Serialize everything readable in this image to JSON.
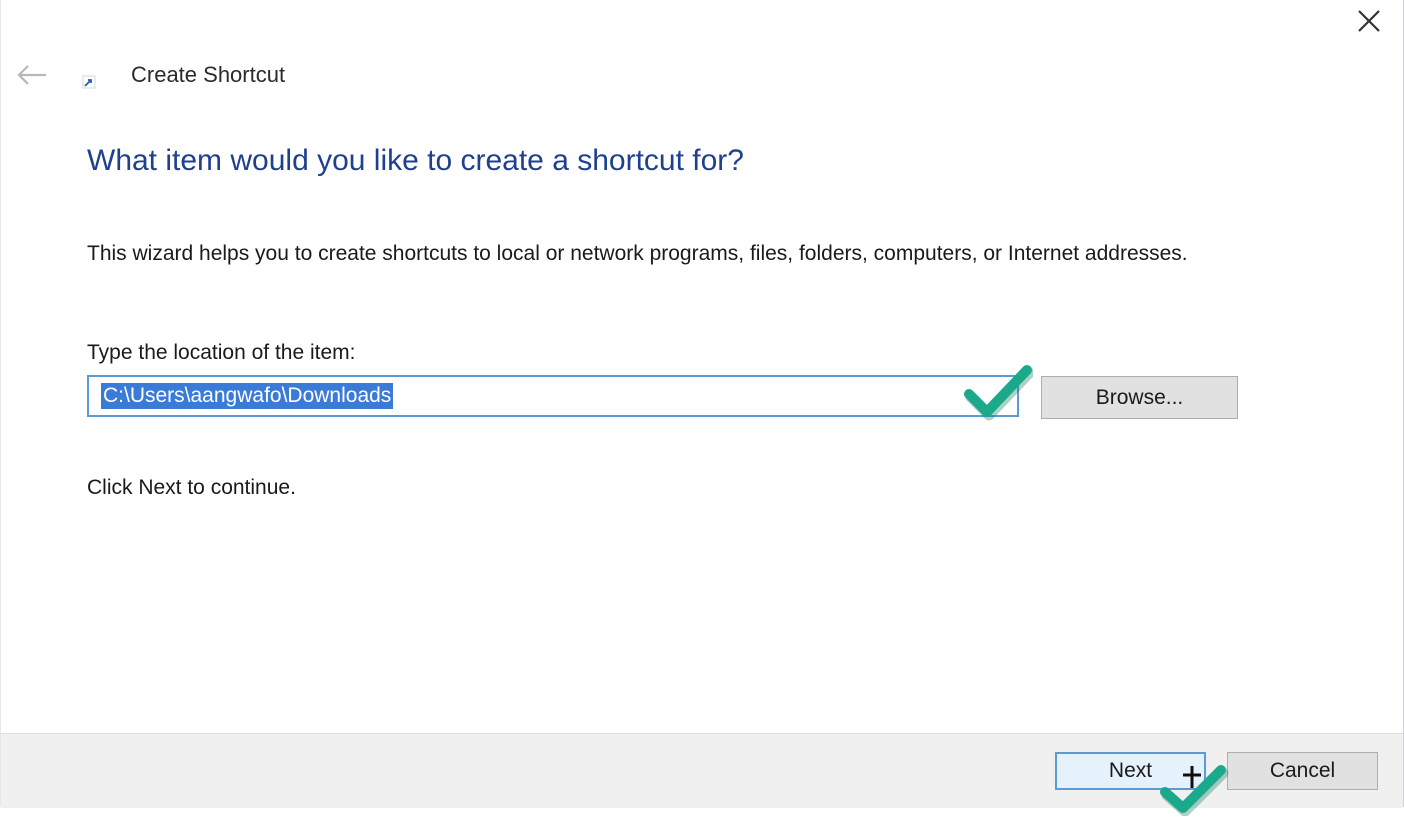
{
  "window": {
    "title": "Create Shortcut"
  },
  "main": {
    "heading": "What item would you like to create a shortcut for?",
    "description": "This wizard helps you to create shortcuts to local or network programs, files, folders, computers, or Internet addresses.",
    "location_label": "Type the location of the item:",
    "location_value": "C:\\Users\\aangwafo\\Downloads",
    "browse_label": "Browse...",
    "hint": "Click Next to continue."
  },
  "footer": {
    "next_label": "Next",
    "cancel_label": "Cancel"
  },
  "colors": {
    "heading": "#1f3f8f",
    "selection": "#3b7bd8",
    "focus_border": "#5b9bd5",
    "check_mark": "#1aa98a"
  },
  "icons": [
    "close-icon",
    "back-arrow-icon",
    "shortcut-icon",
    "checkmark-icon",
    "cursor-icon"
  ]
}
